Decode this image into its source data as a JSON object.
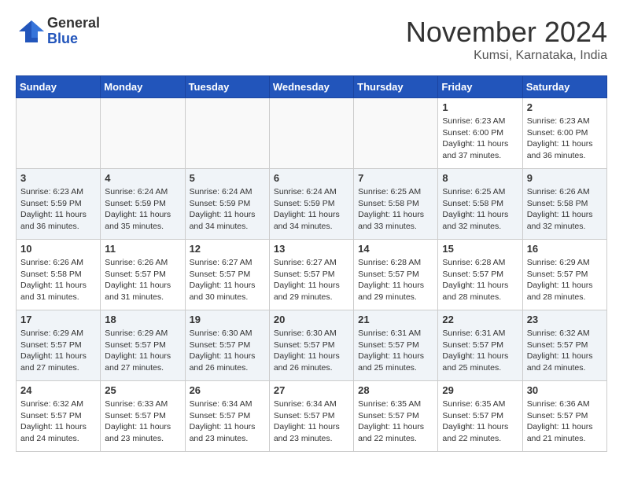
{
  "header": {
    "logo_general": "General",
    "logo_blue": "Blue",
    "month_title": "November 2024",
    "location": "Kumsi, Karnataka, India"
  },
  "days_of_week": [
    "Sunday",
    "Monday",
    "Tuesday",
    "Wednesday",
    "Thursday",
    "Friday",
    "Saturday"
  ],
  "weeks": [
    [
      {
        "day": "",
        "info": ""
      },
      {
        "day": "",
        "info": ""
      },
      {
        "day": "",
        "info": ""
      },
      {
        "day": "",
        "info": ""
      },
      {
        "day": "",
        "info": ""
      },
      {
        "day": "1",
        "info": "Sunrise: 6:23 AM\nSunset: 6:00 PM\nDaylight: 11 hours\nand 37 minutes."
      },
      {
        "day": "2",
        "info": "Sunrise: 6:23 AM\nSunset: 6:00 PM\nDaylight: 11 hours\nand 36 minutes."
      }
    ],
    [
      {
        "day": "3",
        "info": "Sunrise: 6:23 AM\nSunset: 5:59 PM\nDaylight: 11 hours\nand 36 minutes."
      },
      {
        "day": "4",
        "info": "Sunrise: 6:24 AM\nSunset: 5:59 PM\nDaylight: 11 hours\nand 35 minutes."
      },
      {
        "day": "5",
        "info": "Sunrise: 6:24 AM\nSunset: 5:59 PM\nDaylight: 11 hours\nand 34 minutes."
      },
      {
        "day": "6",
        "info": "Sunrise: 6:24 AM\nSunset: 5:59 PM\nDaylight: 11 hours\nand 34 minutes."
      },
      {
        "day": "7",
        "info": "Sunrise: 6:25 AM\nSunset: 5:58 PM\nDaylight: 11 hours\nand 33 minutes."
      },
      {
        "day": "8",
        "info": "Sunrise: 6:25 AM\nSunset: 5:58 PM\nDaylight: 11 hours\nand 32 minutes."
      },
      {
        "day": "9",
        "info": "Sunrise: 6:26 AM\nSunset: 5:58 PM\nDaylight: 11 hours\nand 32 minutes."
      }
    ],
    [
      {
        "day": "10",
        "info": "Sunrise: 6:26 AM\nSunset: 5:58 PM\nDaylight: 11 hours\nand 31 minutes."
      },
      {
        "day": "11",
        "info": "Sunrise: 6:26 AM\nSunset: 5:57 PM\nDaylight: 11 hours\nand 31 minutes."
      },
      {
        "day": "12",
        "info": "Sunrise: 6:27 AM\nSunset: 5:57 PM\nDaylight: 11 hours\nand 30 minutes."
      },
      {
        "day": "13",
        "info": "Sunrise: 6:27 AM\nSunset: 5:57 PM\nDaylight: 11 hours\nand 29 minutes."
      },
      {
        "day": "14",
        "info": "Sunrise: 6:28 AM\nSunset: 5:57 PM\nDaylight: 11 hours\nand 29 minutes."
      },
      {
        "day": "15",
        "info": "Sunrise: 6:28 AM\nSunset: 5:57 PM\nDaylight: 11 hours\nand 28 minutes."
      },
      {
        "day": "16",
        "info": "Sunrise: 6:29 AM\nSunset: 5:57 PM\nDaylight: 11 hours\nand 28 minutes."
      }
    ],
    [
      {
        "day": "17",
        "info": "Sunrise: 6:29 AM\nSunset: 5:57 PM\nDaylight: 11 hours\nand 27 minutes."
      },
      {
        "day": "18",
        "info": "Sunrise: 6:29 AM\nSunset: 5:57 PM\nDaylight: 11 hours\nand 27 minutes."
      },
      {
        "day": "19",
        "info": "Sunrise: 6:30 AM\nSunset: 5:57 PM\nDaylight: 11 hours\nand 26 minutes."
      },
      {
        "day": "20",
        "info": "Sunrise: 6:30 AM\nSunset: 5:57 PM\nDaylight: 11 hours\nand 26 minutes."
      },
      {
        "day": "21",
        "info": "Sunrise: 6:31 AM\nSunset: 5:57 PM\nDaylight: 11 hours\nand 25 minutes."
      },
      {
        "day": "22",
        "info": "Sunrise: 6:31 AM\nSunset: 5:57 PM\nDaylight: 11 hours\nand 25 minutes."
      },
      {
        "day": "23",
        "info": "Sunrise: 6:32 AM\nSunset: 5:57 PM\nDaylight: 11 hours\nand 24 minutes."
      }
    ],
    [
      {
        "day": "24",
        "info": "Sunrise: 6:32 AM\nSunset: 5:57 PM\nDaylight: 11 hours\nand 24 minutes."
      },
      {
        "day": "25",
        "info": "Sunrise: 6:33 AM\nSunset: 5:57 PM\nDaylight: 11 hours\nand 23 minutes."
      },
      {
        "day": "26",
        "info": "Sunrise: 6:34 AM\nSunset: 5:57 PM\nDaylight: 11 hours\nand 23 minutes."
      },
      {
        "day": "27",
        "info": "Sunrise: 6:34 AM\nSunset: 5:57 PM\nDaylight: 11 hours\nand 23 minutes."
      },
      {
        "day": "28",
        "info": "Sunrise: 6:35 AM\nSunset: 5:57 PM\nDaylight: 11 hours\nand 22 minutes."
      },
      {
        "day": "29",
        "info": "Sunrise: 6:35 AM\nSunset: 5:57 PM\nDaylight: 11 hours\nand 22 minutes."
      },
      {
        "day": "30",
        "info": "Sunrise: 6:36 AM\nSunset: 5:57 PM\nDaylight: 11 hours\nand 21 minutes."
      }
    ]
  ]
}
